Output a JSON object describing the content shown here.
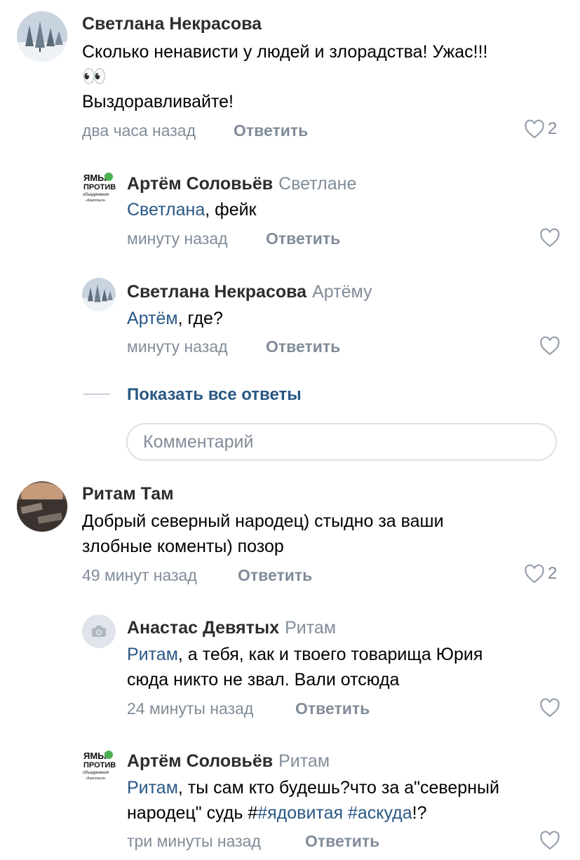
{
  "comments": [
    {
      "author": "Светлана Некрасова",
      "line1": "Сколько ненависти у людей и злорадства! Ужас!!!",
      "emoji": "👀",
      "line2": "Выздоравливайте!",
      "time": "два часа назад",
      "reply_label": "Ответить",
      "likes": "2",
      "replies": [
        {
          "author": "Артём Соловьёв",
          "reply_to": "Светлане",
          "mention": "Светлана",
          "text": ", фейк",
          "time": "минуту назад",
          "reply_label": "Ответить"
        },
        {
          "author": "Светлана Некрасова",
          "reply_to": "Артёму",
          "mention": "Артём",
          "text": ", где?",
          "time": "минуту назад",
          "reply_label": "Ответить"
        }
      ],
      "show_all": "Показать все ответы",
      "comment_placeholder": "Комментарий"
    },
    {
      "author": "Ритам Там",
      "line1": "Добрый северный народец) стыдно за ваши",
      "line2": "злобные коменты) позор",
      "time": "49 минут назад",
      "reply_label": "Ответить",
      "likes": "2",
      "replies": [
        {
          "author": "Анастас Девятых",
          "reply_to": "Ритам",
          "mention": "Ритам",
          "text1": ", а тебя, как и твоего товарища Юрия",
          "text2": "сюда никто не звал. Вали отсюда",
          "time": "24 минуты назад",
          "reply_label": "Ответить"
        },
        {
          "author": "Артём Соловьёв",
          "reply_to": "Ритам",
          "mention": "Ритам",
          "text1": ", ты сам кто будешь?что за а\"северный",
          "text2a": "народец\" судь #",
          "hashtag1": "#ядовитая",
          "hashtag2": "#аскуда",
          "text2b": "!?",
          "time": "три минуты назад",
          "reply_label": "Ответить"
        }
      ]
    }
  ],
  "avatar_logo_text": [
    "Я",
    "МЫ",
    "ПРОТИВ",
    "объединения",
    "Кангельск"
  ],
  "colors": {
    "link": "#2a5885",
    "meta": "#818c99",
    "name": "#2c2d2e"
  }
}
